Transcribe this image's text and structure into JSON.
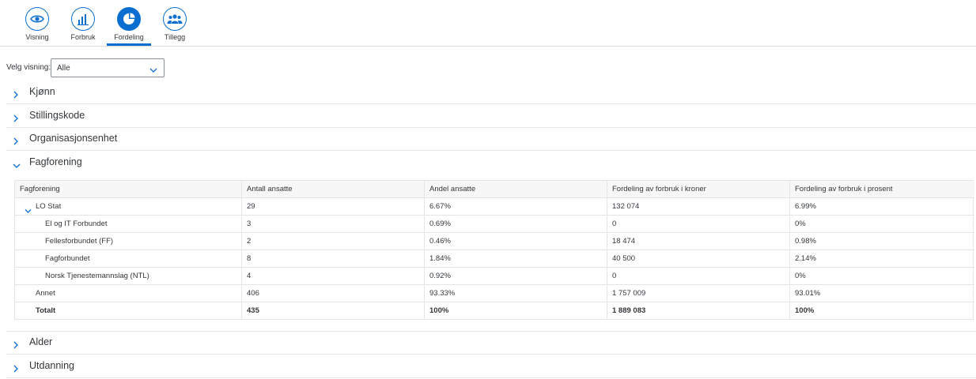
{
  "tabs": [
    {
      "label": "Visning",
      "icon": "eye-icon",
      "active": false
    },
    {
      "label": "Forbruk",
      "icon": "bar-chart-icon",
      "active": false
    },
    {
      "label": "Fordeling",
      "icon": "pie-chart-icon",
      "active": true
    },
    {
      "label": "Tillegg",
      "icon": "people-icon",
      "active": false
    }
  ],
  "filter": {
    "label": "Velg visning:",
    "value": "Alle"
  },
  "panels": {
    "kjonn": "Kjønn",
    "stillingskode": "Stillingskode",
    "organisasjonsenhet": "Organisasjonsenhet",
    "fagforening": "Fagforening",
    "alder": "Alder",
    "utdanning": "Utdanning"
  },
  "table": {
    "headers": [
      "Fagforening",
      "Antall ansatte",
      "Andel ansatte",
      "Fordeling av forbruk i kroner",
      "Fordeling av forbruk i prosent"
    ],
    "rows": [
      [
        "LO Stat",
        "29",
        "6.67%",
        "132 074",
        "6.99%"
      ],
      [
        "El og IT Forbundet",
        "3",
        "0.69%",
        "0",
        "0%"
      ],
      [
        "Fellesforbundet (FF)",
        "2",
        "0.46%",
        "18 474",
        "0.98%"
      ],
      [
        "Fagforbundet",
        "8",
        "1.84%",
        "40 500",
        "2.14%"
      ],
      [
        "Norsk Tjenestemannslag (NTL)",
        "4",
        "0.92%",
        "0",
        "0%"
      ],
      [
        "Annet",
        "406",
        "93.33%",
        "1 757 009",
        "93.01%"
      ],
      [
        "Totalt",
        "435",
        "100%",
        "1 889 083",
        "100%"
      ]
    ]
  },
  "colors": {
    "accent": "#0a6ed1",
    "text": "#32363a",
    "border": "#e5e5e5"
  }
}
